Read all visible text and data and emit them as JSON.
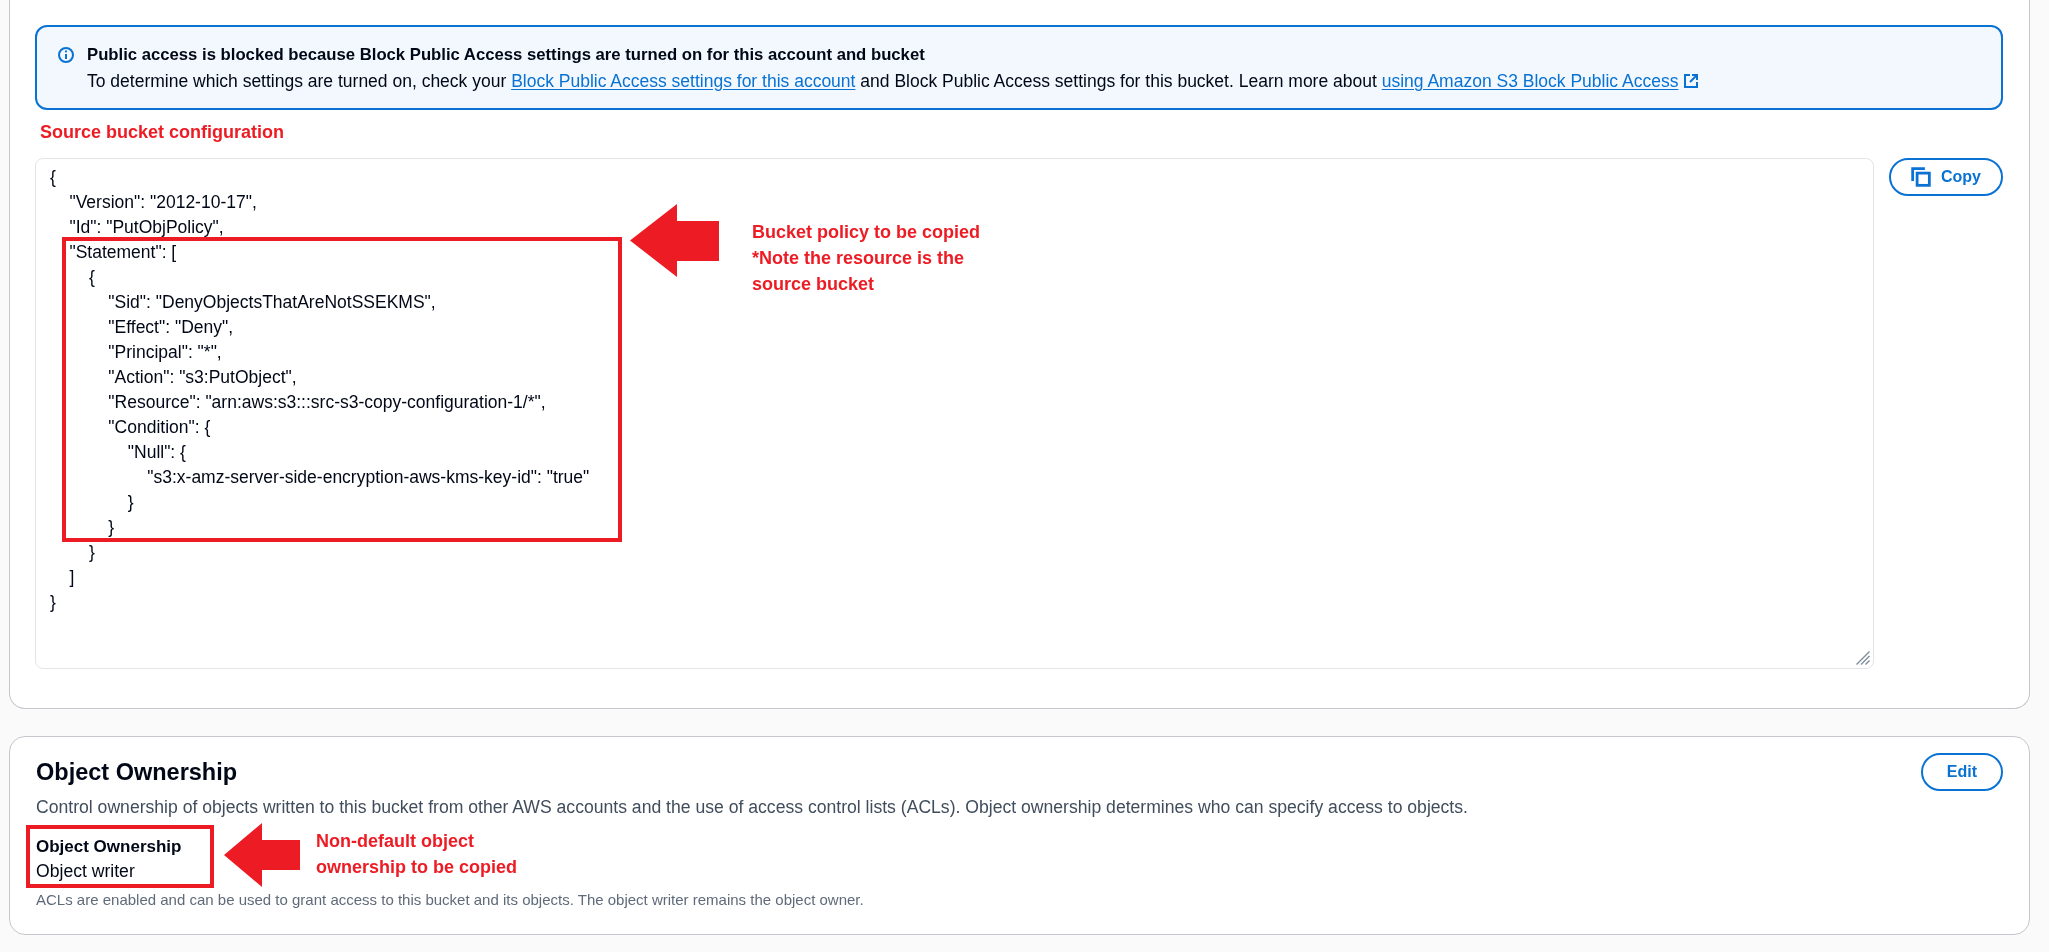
{
  "info_banner": {
    "title": "Public access is blocked because Block Public Access settings are turned on for this account and bucket",
    "message": [
      {
        "kind": "text",
        "text": "To determine which settings are turned on, check your "
      },
      {
        "kind": "link",
        "text": "Block Public Access settings for this account",
        "external": false
      },
      {
        "kind": "text",
        "text": " and Block Public Access settings for this bucket. Learn more about "
      },
      {
        "kind": "link",
        "text": "using Amazon S3 Block Public Access",
        "external": true
      }
    ]
  },
  "policy_section": {
    "annotation": "Source bucket configuration",
    "editor": {
      "value": "{\n    \"Version\": \"2012-10-17\",\n    \"Id\": \"PutObjPolicy\",\n    \"Statement\": [\n        {\n            \"Sid\": \"DenyObjectsThatAreNotSSEKMS\",\n            \"Effect\": \"Deny\",\n            \"Principal\": \"*\",\n            \"Action\": \"s3:PutObject\",\n            \"Resource\": \"arn:aws:s3:::src-s3-copy-configuration-1/*\",\n            \"Condition\": {\n                \"Null\": {\n                    \"s3:x-amz-server-side-encryption-aws-kms-key-id\": \"true\"\n                }\n            }\n        }\n    ]\n}"
    },
    "copy_button": "Copy",
    "callout": [
      "Bucket policy to be copied",
      "*Note the resource is the source bucket"
    ]
  },
  "object_ownership": {
    "heading": "Object Ownership",
    "edit_button": "Edit",
    "description": "Control ownership of objects written to this bucket from other AWS accounts and the use of access control lists (ACLs). Object ownership determines who can specify access to objects.",
    "field": {
      "label": "Object Ownership",
      "value": "Object writer",
      "help": "ACLs are enabled and can be used to grant access to this bucket and its objects. The object writer remains the object owner."
    },
    "callout": "Non-default object ownership to be copied"
  }
}
